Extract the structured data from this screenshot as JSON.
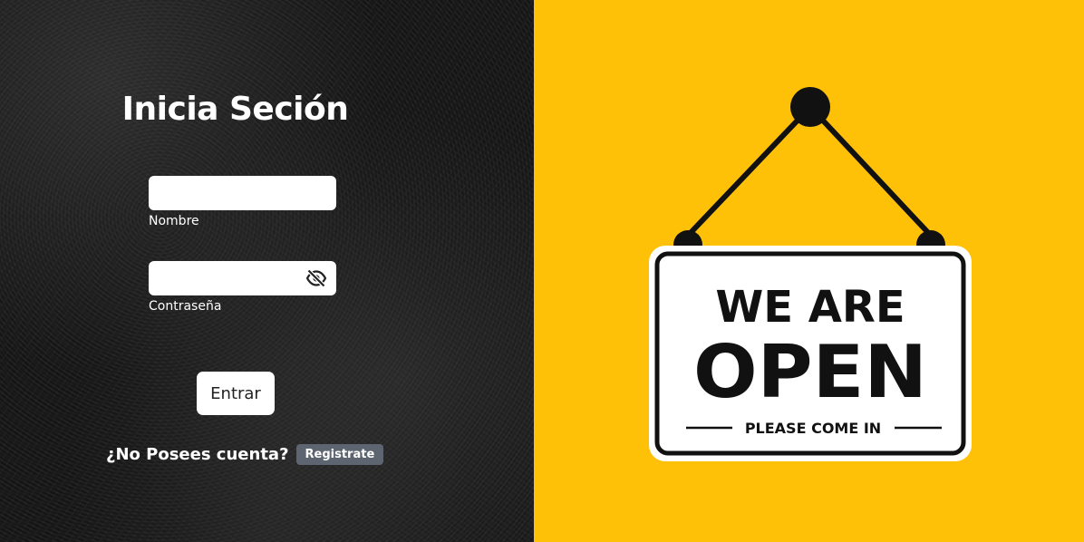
{
  "login": {
    "title": "Inicia Seción",
    "name_field": {
      "label": "Nombre",
      "value": ""
    },
    "password_field": {
      "label": "Contraseña",
      "value": ""
    },
    "submit_label": "Entrar",
    "register_prompt": "¿No Posees cuenta?",
    "register_link": "Registrate"
  },
  "promo": {
    "sign_line1": "WE ARE",
    "sign_line2": "OPEN",
    "sign_line3": "PLEASE COME IN",
    "background_color": "#ffc107"
  },
  "icons": {
    "password_toggle": "eye-slash-icon"
  }
}
